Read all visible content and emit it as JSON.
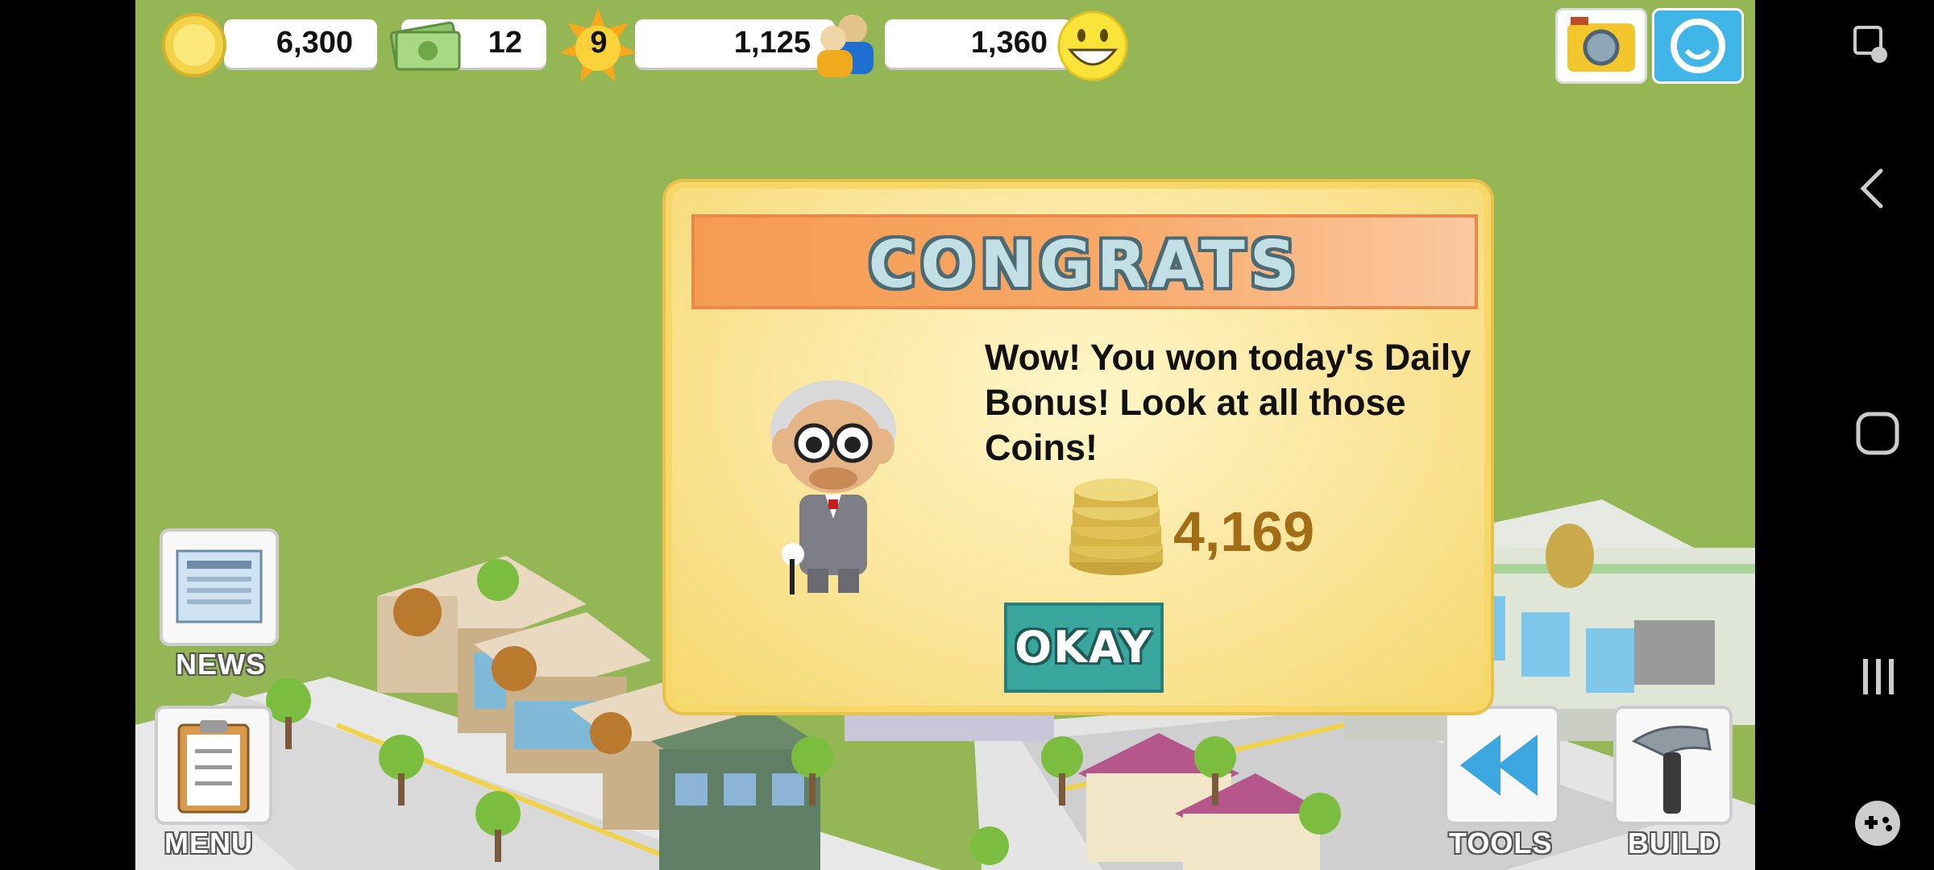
{
  "hud": {
    "coins": "6,300",
    "cash": "12",
    "level": "9",
    "experience": "1,125",
    "population": "1,360"
  },
  "dialog": {
    "title": "CONGRATS",
    "message": "Wow! You won today's Daily Bonus! Look at all those Coins!",
    "reward_amount": "4,169",
    "button_label": "OKAY"
  },
  "side_menu": {
    "news_label": "NEWS",
    "menu_label": "MENU",
    "tools_label": "TOOLS",
    "build_label": "BUILD"
  },
  "colors": {
    "grass": "#95b655",
    "dialog_bg": "#f6d768",
    "banner": "#f69b52",
    "okay_button": "#3aa79f",
    "reward_text": "#a36c17"
  },
  "icons": [
    "coin-icon",
    "cash-icon",
    "level-sun-icon",
    "population-icon",
    "happiness-smiley-icon",
    "camera-icon",
    "share-icon",
    "news-icon",
    "clipboard-icon",
    "rewind-icon",
    "hammer-icon",
    "pen-icon",
    "coin-stack-icon",
    "mascot-old-man"
  ]
}
